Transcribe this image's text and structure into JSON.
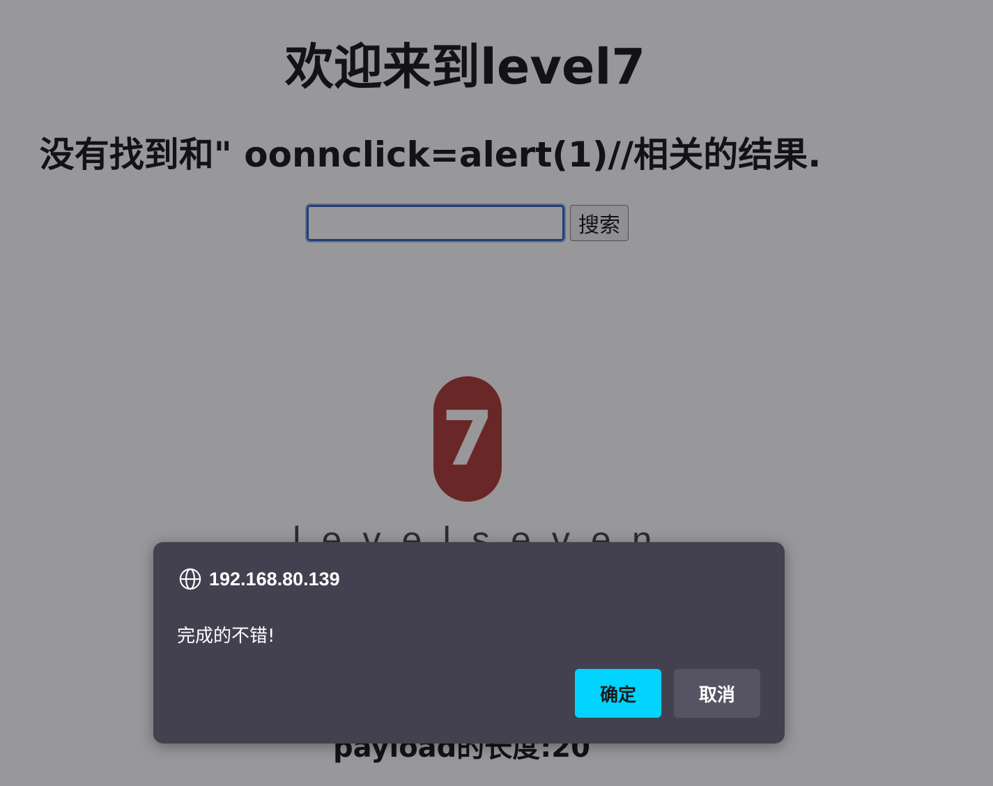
{
  "page": {
    "title": "欢迎来到level7",
    "result_heading": "没有找到和\" oonnclick=alert(1)//相关的结果.",
    "search": {
      "value": "",
      "button_label": "搜索"
    },
    "logo": {
      "badge_text": "7",
      "wordmark": "levelseven"
    },
    "payload_length": "payload的长度:20"
  },
  "dialog": {
    "origin": "192.168.80.139",
    "message": "完成的不错!",
    "ok_label": "确定",
    "cancel_label": "取消"
  },
  "colors": {
    "overlay": "#2a2830",
    "dialog_bg": "#43414f",
    "ok_button": "#00d4ff",
    "cancel_button": "#565463",
    "input_focus_border": "#1a56b8",
    "logo_badge": "#a72a24"
  },
  "icons": {
    "dialog_origin_icon": "globe-icon"
  }
}
